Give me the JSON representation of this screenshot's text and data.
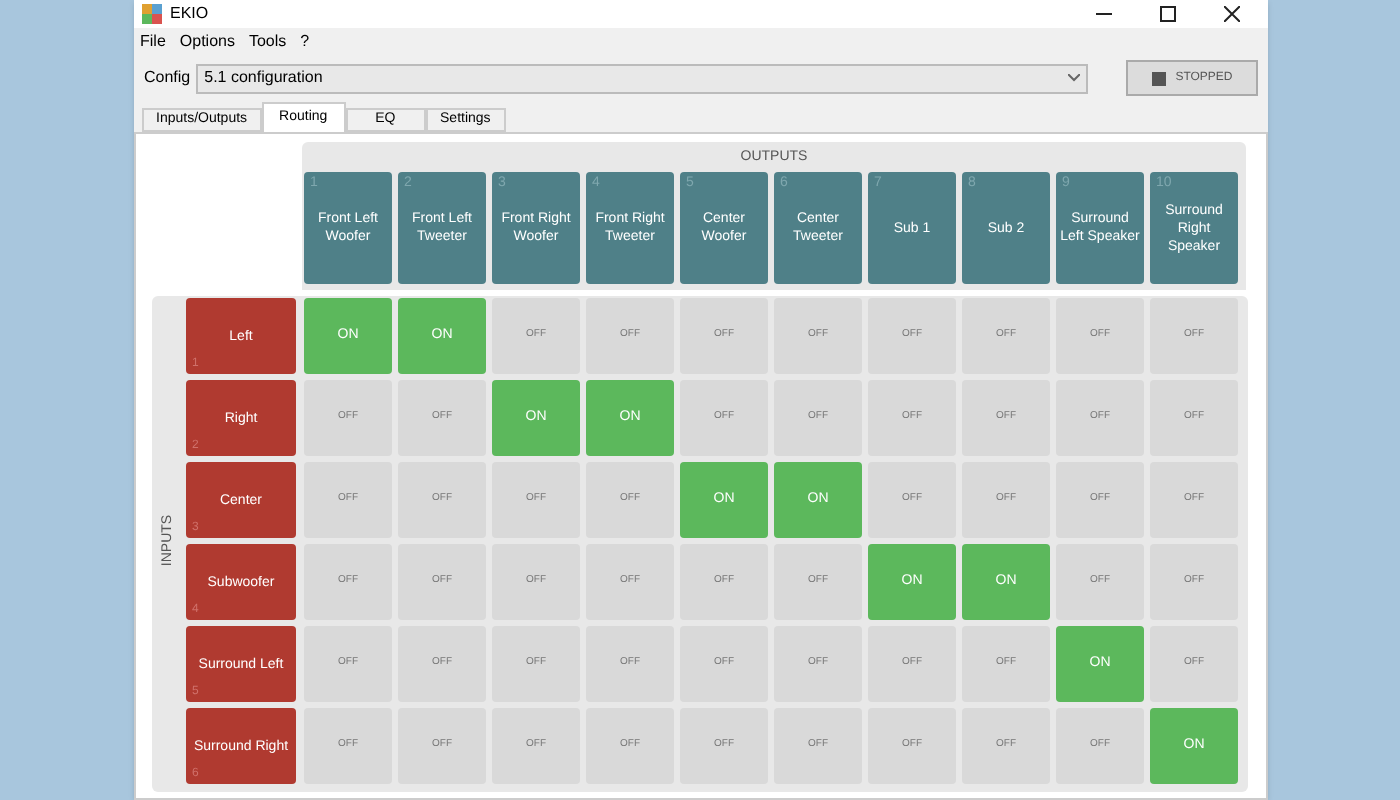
{
  "window": {
    "title": "EKIO"
  },
  "menu": [
    "File",
    "Options",
    "Tools",
    "?"
  ],
  "config": {
    "label": "Config",
    "value": "5.1 configuration"
  },
  "stop_button": {
    "label": "STOPPED"
  },
  "tabs": [
    {
      "label": "Inputs/Outputs",
      "selected": false
    },
    {
      "label": "Routing",
      "selected": true
    },
    {
      "label": "EQ",
      "selected": false
    },
    {
      "label": "Settings",
      "selected": false
    }
  ],
  "routing": {
    "outputs_title": "OUTPUTS",
    "inputs_title": "INPUTS",
    "outputs": [
      {
        "number": "1",
        "name": "Front Left Woofer"
      },
      {
        "number": "2",
        "name": "Front Left Tweeter"
      },
      {
        "number": "3",
        "name": "Front Right Woofer"
      },
      {
        "number": "4",
        "name": "Front Right Tweeter"
      },
      {
        "number": "5",
        "name": "Center Woofer"
      },
      {
        "number": "6",
        "name": "Center Tweeter"
      },
      {
        "number": "7",
        "name": "Sub 1"
      },
      {
        "number": "8",
        "name": "Sub 2"
      },
      {
        "number": "9",
        "name": "Surround Left Speaker"
      },
      {
        "number": "10",
        "name": "Surround Right Speaker"
      }
    ],
    "inputs": [
      {
        "number": "1",
        "name": "Left",
        "cells": [
          {
            "label": "ON",
            "on": true
          },
          {
            "label": "ON",
            "on": true
          },
          {
            "label": "OFF",
            "on": false
          },
          {
            "label": "OFF",
            "on": false
          },
          {
            "label": "OFF",
            "on": false
          },
          {
            "label": "OFF",
            "on": false
          },
          {
            "label": "OFF",
            "on": false
          },
          {
            "label": "OFF",
            "on": false
          },
          {
            "label": "OFF",
            "on": false
          },
          {
            "label": "OFF",
            "on": false
          }
        ]
      },
      {
        "number": "2",
        "name": "Right",
        "cells": [
          {
            "label": "OFF",
            "on": false
          },
          {
            "label": "OFF",
            "on": false
          },
          {
            "label": "ON",
            "on": true
          },
          {
            "label": "ON",
            "on": true
          },
          {
            "label": "OFF",
            "on": false
          },
          {
            "label": "OFF",
            "on": false
          },
          {
            "label": "OFF",
            "on": false
          },
          {
            "label": "OFF",
            "on": false
          },
          {
            "label": "OFF",
            "on": false
          },
          {
            "label": "OFF",
            "on": false
          }
        ]
      },
      {
        "number": "3",
        "name": "Center",
        "cells": [
          {
            "label": "OFF",
            "on": false
          },
          {
            "label": "OFF",
            "on": false
          },
          {
            "label": "OFF",
            "on": false
          },
          {
            "label": "OFF",
            "on": false
          },
          {
            "label": "ON",
            "on": true
          },
          {
            "label": "ON",
            "on": true
          },
          {
            "label": "OFF",
            "on": false
          },
          {
            "label": "OFF",
            "on": false
          },
          {
            "label": "OFF",
            "on": false
          },
          {
            "label": "OFF",
            "on": false
          }
        ]
      },
      {
        "number": "4",
        "name": "Subwoofer",
        "cells": [
          {
            "label": "OFF",
            "on": false
          },
          {
            "label": "OFF",
            "on": false
          },
          {
            "label": "OFF",
            "on": false
          },
          {
            "label": "OFF",
            "on": false
          },
          {
            "label": "OFF",
            "on": false
          },
          {
            "label": "OFF",
            "on": false
          },
          {
            "label": "ON",
            "on": true
          },
          {
            "label": "ON",
            "on": true
          },
          {
            "label": "OFF",
            "on": false
          },
          {
            "label": "OFF",
            "on": false
          }
        ]
      },
      {
        "number": "5",
        "name": "Surround Left",
        "cells": [
          {
            "label": "OFF",
            "on": false
          },
          {
            "label": "OFF",
            "on": false
          },
          {
            "label": "OFF",
            "on": false
          },
          {
            "label": "OFF",
            "on": false
          },
          {
            "label": "OFF",
            "on": false
          },
          {
            "label": "OFF",
            "on": false
          },
          {
            "label": "OFF",
            "on": false
          },
          {
            "label": "OFF",
            "on": false
          },
          {
            "label": "ON",
            "on": true
          },
          {
            "label": "OFF",
            "on": false
          }
        ]
      },
      {
        "number": "6",
        "name": "Surround Right",
        "cells": [
          {
            "label": "OFF",
            "on": false
          },
          {
            "label": "OFF",
            "on": false
          },
          {
            "label": "OFF",
            "on": false
          },
          {
            "label": "OFF",
            "on": false
          },
          {
            "label": "OFF",
            "on": false
          },
          {
            "label": "OFF",
            "on": false
          },
          {
            "label": "OFF",
            "on": false
          },
          {
            "label": "OFF",
            "on": false
          },
          {
            "label": "OFF",
            "on": false
          },
          {
            "label": "ON",
            "on": true
          }
        ]
      }
    ]
  }
}
